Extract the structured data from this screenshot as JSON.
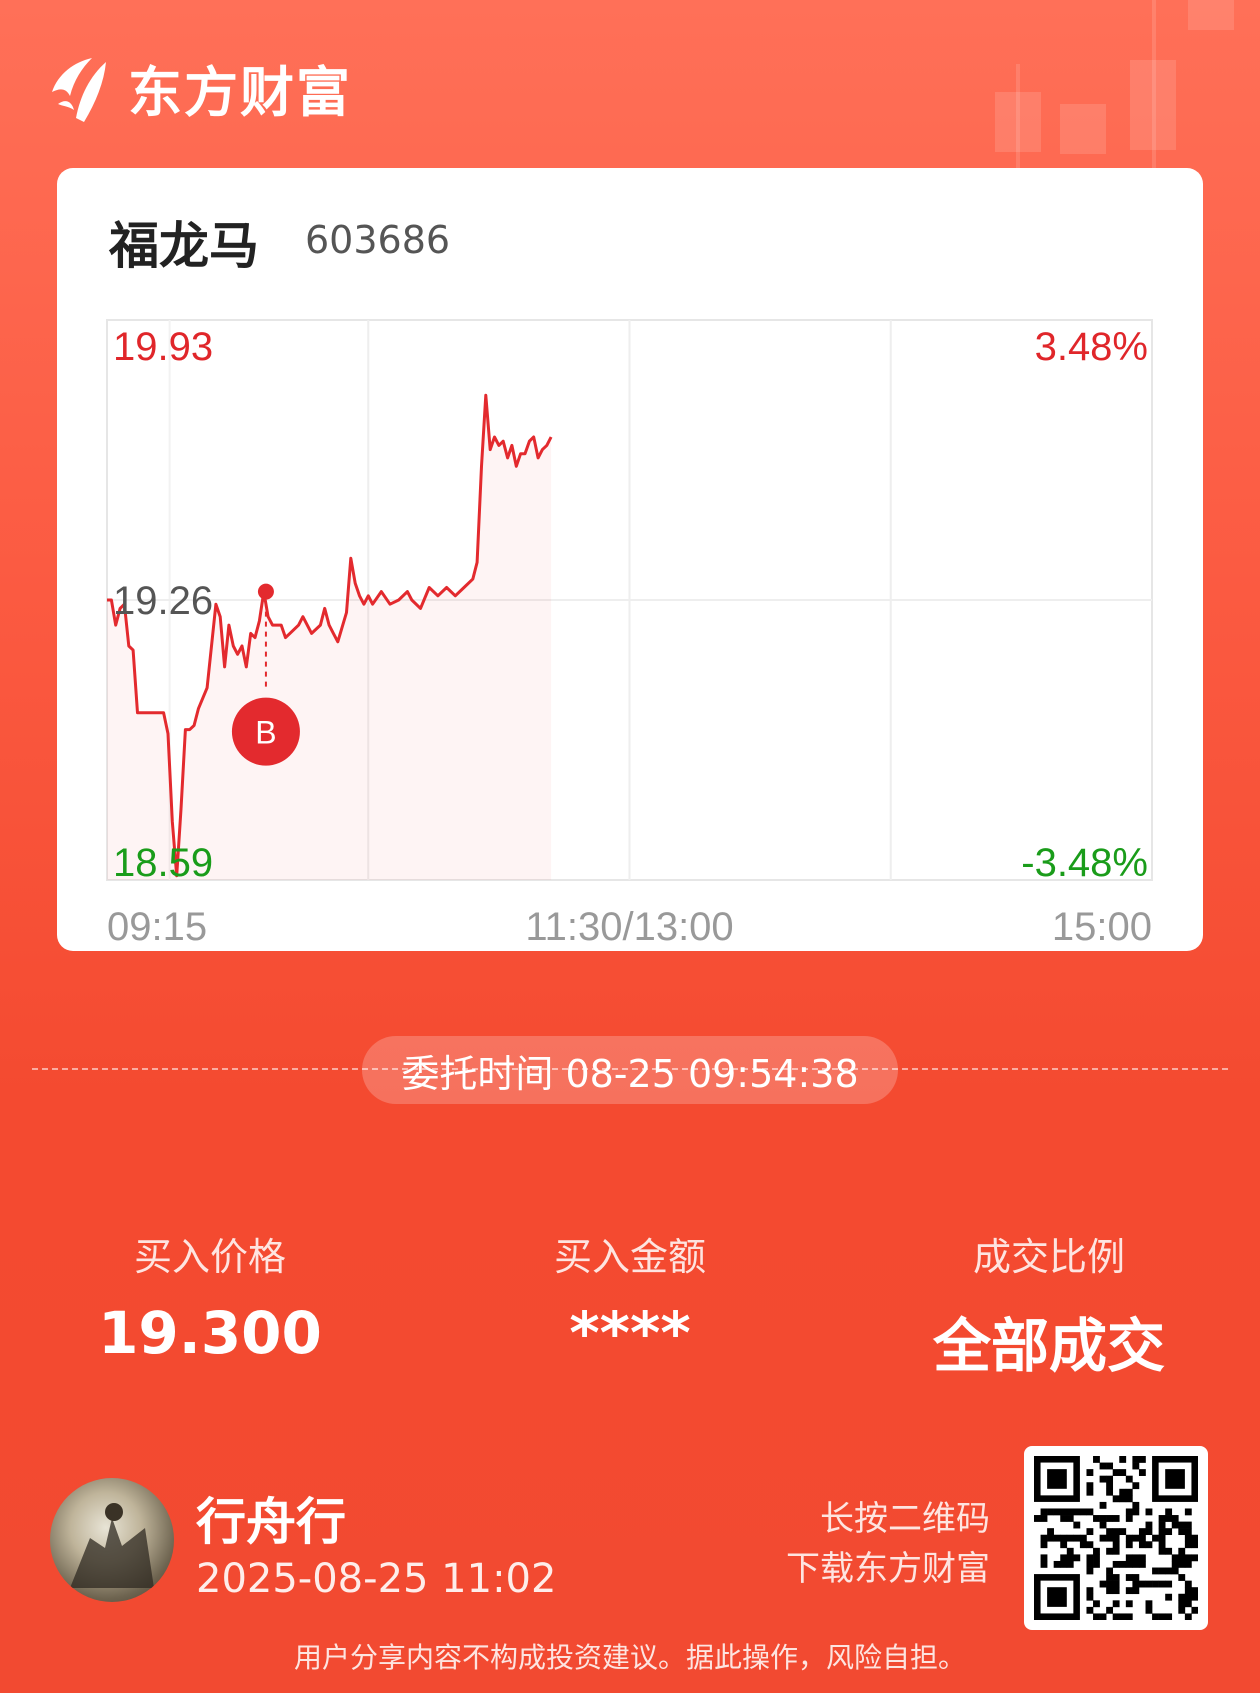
{
  "brand": {
    "name": "东方财富"
  },
  "stock": {
    "name": "福龙马",
    "code": "603686"
  },
  "chart_data": {
    "type": "line",
    "price_labels": {
      "top": "19.93",
      "mid": "19.26",
      "bottom": "18.59"
    },
    "pct_labels": {
      "top": "3.48%",
      "bottom": "-3.48%"
    },
    "x_tick_labels": [
      "09:15",
      "11:30/13:00",
      "15:00"
    ],
    "ylim": [
      18.59,
      19.93
    ],
    "reference_price": 19.26,
    "x_range_minutes": [
      0,
      240
    ],
    "x_label_pos_minutes": [
      0,
      120,
      240
    ],
    "series": [
      {
        "points": [
          [
            0,
            19.26
          ],
          [
            1,
            19.26
          ],
          [
            2,
            19.2
          ],
          [
            3,
            19.24
          ],
          [
            4,
            19.25
          ],
          [
            5,
            19.15
          ],
          [
            6,
            19.14
          ],
          [
            7,
            18.99
          ],
          [
            8,
            18.99
          ],
          [
            11,
            18.99
          ],
          [
            13,
            18.99
          ],
          [
            14,
            18.94
          ],
          [
            15,
            18.73
          ],
          [
            16,
            18.6
          ],
          [
            17,
            18.76
          ],
          [
            18,
            18.95
          ],
          [
            19,
            18.95
          ],
          [
            20,
            18.96
          ],
          [
            21,
            19.0
          ],
          [
            23,
            19.05
          ],
          [
            25,
            19.25
          ],
          [
            26,
            19.22
          ],
          [
            27,
            19.1
          ],
          [
            28,
            19.2
          ],
          [
            29,
            19.15
          ],
          [
            30,
            19.13
          ],
          [
            31,
            19.15
          ],
          [
            32,
            19.1
          ],
          [
            33,
            19.18
          ],
          [
            34,
            19.17
          ],
          [
            35,
            19.21
          ],
          [
            36,
            19.28
          ],
          [
            37,
            19.22
          ],
          [
            38,
            19.2
          ],
          [
            39,
            19.2
          ],
          [
            40,
            19.2
          ],
          [
            41,
            19.17
          ],
          [
            42,
            19.18
          ],
          [
            44,
            19.2
          ],
          [
            45,
            19.22
          ],
          [
            47,
            19.18
          ],
          [
            49,
            19.2
          ],
          [
            50,
            19.24
          ],
          [
            51,
            19.2
          ],
          [
            52,
            19.18
          ],
          [
            53,
            19.16
          ],
          [
            55,
            19.23
          ],
          [
            56,
            19.36
          ],
          [
            57,
            19.3
          ],
          [
            58,
            19.27
          ],
          [
            59,
            19.25
          ],
          [
            60,
            19.27
          ],
          [
            61,
            19.25
          ],
          [
            63,
            19.28
          ],
          [
            65,
            19.25
          ],
          [
            67,
            19.26
          ],
          [
            69,
            19.28
          ],
          [
            70,
            19.26
          ],
          [
            72,
            19.24
          ],
          [
            74,
            19.29
          ],
          [
            76,
            19.27
          ],
          [
            78,
            19.29
          ],
          [
            80,
            19.27
          ],
          [
            82,
            19.29
          ],
          [
            84,
            19.31
          ],
          [
            85,
            19.35
          ],
          [
            86,
            19.58
          ],
          [
            87,
            19.75
          ],
          [
            88,
            19.62
          ],
          [
            89,
            19.65
          ],
          [
            90,
            19.63
          ],
          [
            91,
            19.64
          ],
          [
            92,
            19.6
          ],
          [
            93,
            19.63
          ],
          [
            94,
            19.58
          ],
          [
            95,
            19.61
          ],
          [
            96,
            19.61
          ],
          [
            97,
            19.64
          ],
          [
            98,
            19.65
          ],
          [
            99,
            19.6
          ],
          [
            100,
            19.62
          ],
          [
            101,
            19.63
          ],
          [
            102,
            19.65
          ]
        ]
      }
    ],
    "buy_marker": {
      "label": "B",
      "minute": 36.5,
      "price": 19.28
    }
  },
  "order": {
    "time_text": "委托时间 08-25 09:54:38"
  },
  "stats": [
    {
      "label": "买入价格",
      "value": "19.300"
    },
    {
      "label": "买入金额",
      "value": "****"
    },
    {
      "label": "成交比例",
      "value": "全部成交"
    }
  ],
  "user": {
    "name": "行舟行",
    "time": "2025-08-25 11:02"
  },
  "qr_hint": {
    "line1": "长按二维码",
    "line2": "下载东方财富"
  },
  "disclaimer": "用户分享内容不构成投资建议。据此操作，风险自担。",
  "colors": {
    "up": "#e0262a",
    "down": "#1a9c1a",
    "mid": "#555555",
    "line": "#e32a2e"
  }
}
